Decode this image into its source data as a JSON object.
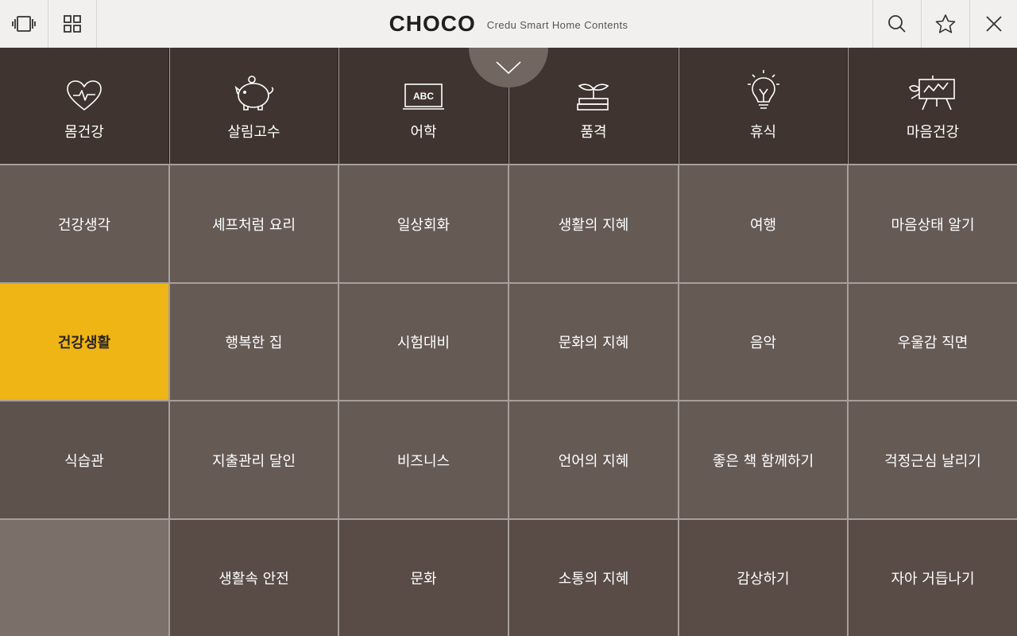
{
  "header": {
    "logo": "CHOCO",
    "tagline": "Credu Smart Home Contents",
    "left_icons": [
      "cards-view-icon",
      "grid-view-icon"
    ],
    "right_icons": [
      "search-icon",
      "star-icon",
      "close-icon"
    ]
  },
  "categories": [
    {
      "label": "몸건강",
      "icon": "heart-pulse-icon"
    },
    {
      "label": "살림고수",
      "icon": "piggy-bank-icon"
    },
    {
      "label": "어학",
      "icon": "abc-board-icon"
    },
    {
      "label": "품격",
      "icon": "sprout-books-icon"
    },
    {
      "label": "휴식",
      "icon": "lightbulb-icon"
    },
    {
      "label": "마음건강",
      "icon": "easel-icon"
    }
  ],
  "rows": [
    [
      "건강생각",
      "셰프처럼 요리",
      "일상회화",
      "생활의 지혜",
      "여행",
      "마음상태 알기"
    ],
    [
      "건강생활",
      "행복한 집",
      "시험대비",
      "문화의 지혜",
      "음악",
      "우울감 직면"
    ],
    [
      "식습관",
      "지출관리 달인",
      "비즈니스",
      "언어의 지혜",
      "좋은 책 함께하기",
      "걱정근심 날리기"
    ],
    [
      "",
      "생활속 안전",
      "문화",
      "소통의 지혜",
      "감상하기",
      "자아 거듭나기"
    ]
  ],
  "selected": {
    "row": 1,
    "col": 0
  },
  "colors": {
    "accent": "#eeb515",
    "category_bg": "#3f3430",
    "cell_bg": "#665a55",
    "header_bg": "#f1f0ee"
  }
}
